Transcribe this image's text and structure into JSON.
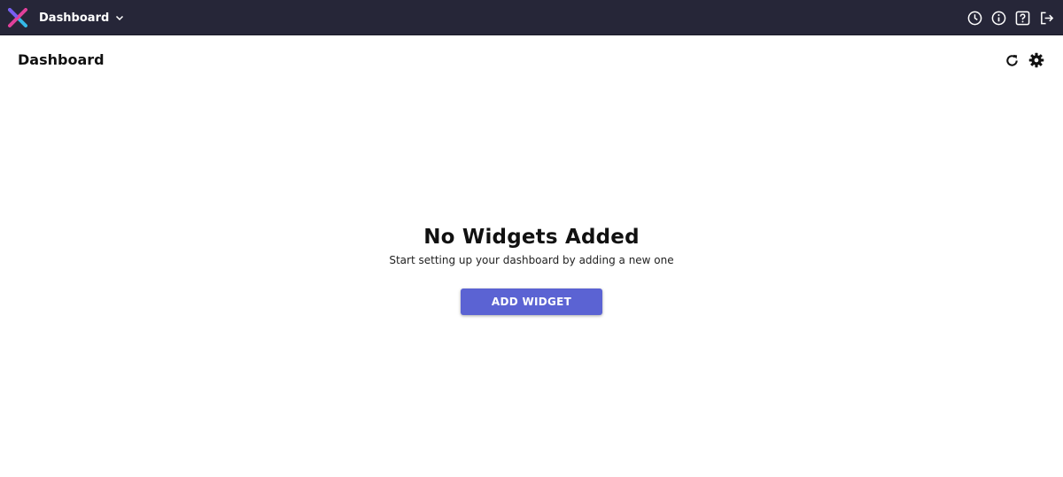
{
  "topbar": {
    "app_name": "Dashboard",
    "icons": [
      "history-icon",
      "info-icon",
      "help-icon",
      "logout-icon"
    ]
  },
  "header": {
    "title": "Dashboard",
    "actions": [
      "refresh-icon",
      "settings-gear-icon"
    ]
  },
  "empty_state": {
    "title": "No Widgets Added",
    "subtitle": "Start setting up your dashboard by adding a new one",
    "button_label": "ADD WIDGET"
  },
  "colors": {
    "topbar_bg": "#262638",
    "button_bg": "#5b63d3",
    "logo_pink": "#e0409a",
    "logo_cyan": "#35b8e6"
  }
}
